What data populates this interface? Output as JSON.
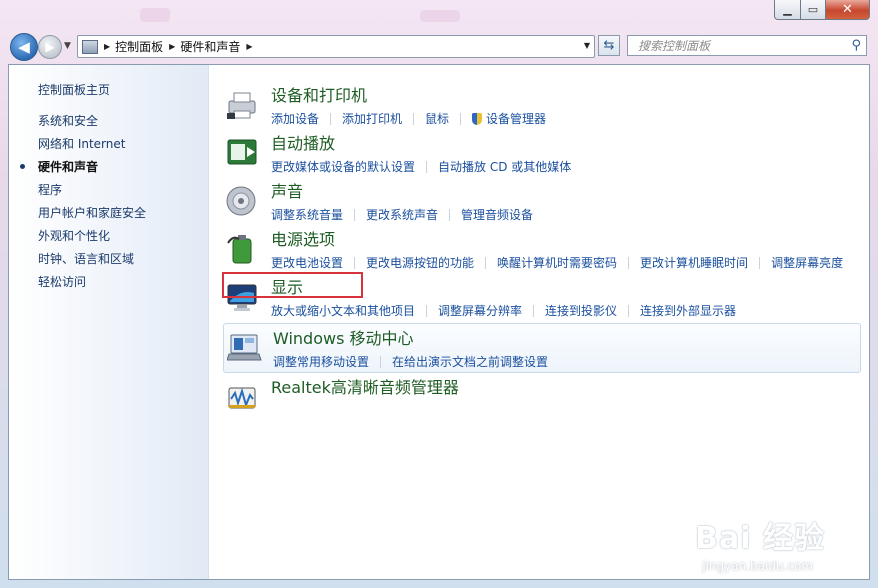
{
  "window": {
    "controls": {
      "minimize": "▁",
      "maximize": "▭",
      "close": "✕"
    }
  },
  "nav": {
    "back_glyph": "◀",
    "forward_glyph": "▶",
    "breadcrumbs": [
      "控制面板",
      "硬件和声音"
    ],
    "search_placeholder": "搜索控制面板"
  },
  "sidebar": {
    "home": "控制面板主页",
    "items": [
      {
        "label": "系统和安全",
        "active": false
      },
      {
        "label": "网络和 Internet",
        "active": false
      },
      {
        "label": "硬件和声音",
        "active": true
      },
      {
        "label": "程序",
        "active": false
      },
      {
        "label": "用户帐户和家庭安全",
        "active": false
      },
      {
        "label": "外观和个性化",
        "active": false
      },
      {
        "label": "时钟、语言和区域",
        "active": false
      },
      {
        "label": "轻松访问",
        "active": false
      }
    ]
  },
  "categories": [
    {
      "title": "设备和打印机",
      "icon": "printer-icon",
      "links": [
        "添加设备",
        "添加打印机",
        "鼠标",
        "设备管理器"
      ]
    },
    {
      "title": "自动播放",
      "icon": "autoplay-icon",
      "links": [
        "更改媒体或设备的默认设置",
        "自动播放 CD 或其他媒体"
      ]
    },
    {
      "title": "声音",
      "icon": "speaker-icon",
      "links": [
        "调整系统音量",
        "更改系统声音",
        "管理音频设备"
      ]
    },
    {
      "title": "电源选项",
      "icon": "battery-icon",
      "links": [
        "更改电池设置",
        "更改电源按钮的功能",
        "唤醒计算机时需要密码",
        "更改计算机睡眠时间",
        "调整屏幕亮度"
      ]
    },
    {
      "title": "显示",
      "icon": "monitor-icon",
      "links": [
        "放大或缩小文本和其他项目",
        "调整屏幕分辨率",
        "连接到投影仪",
        "连接到外部显示器"
      ]
    },
    {
      "title": "Windows 移动中心",
      "icon": "mobility-center-icon",
      "links": [
        "调整常用移动设置",
        "在给出演示文档之前调整设置"
      ]
    },
    {
      "title": "Realtek高清晰音频管理器",
      "icon": "realtek-audio-icon",
      "links": []
    }
  ],
  "watermark": {
    "text": "Bai 经验",
    "url": "jingyan.baidu.com"
  }
}
